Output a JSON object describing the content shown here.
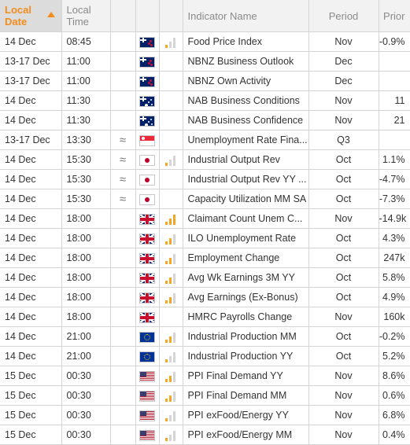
{
  "columns": {
    "local_date": "Local Date",
    "local_time": "Local Time",
    "indicator_name": "Indicator Name",
    "period": "Period",
    "prior": "Prior"
  },
  "rows": [
    {
      "date": "14 Dec",
      "time": "08:45",
      "approx": "",
      "flag": "nz-flag-icon",
      "flag_class": "flag-nz",
      "vol": 1,
      "name": "Food Price Index",
      "period": "Nov",
      "prior": "-0.9%"
    },
    {
      "date": "13-17 Dec",
      "time": "11:00",
      "approx": "",
      "flag": "nz-flag-icon",
      "flag_class": "flag-nz",
      "vol": 0,
      "name": "NBNZ Business Outlook",
      "period": "Dec",
      "prior": ""
    },
    {
      "date": "13-17 Dec",
      "time": "11:00",
      "approx": "",
      "flag": "nz-flag-icon",
      "flag_class": "flag-nz",
      "vol": 0,
      "name": "NBNZ Own Activity",
      "period": "Dec",
      "prior": ""
    },
    {
      "date": "14 Dec",
      "time": "11:30",
      "approx": "",
      "flag": "au-flag-icon",
      "flag_class": "flag-au",
      "vol": 0,
      "name": "NAB Business Conditions",
      "period": "Nov",
      "prior": "11"
    },
    {
      "date": "14 Dec",
      "time": "11:30",
      "approx": "",
      "flag": "au-flag-icon",
      "flag_class": "flag-au",
      "vol": 0,
      "name": "NAB Business Confidence",
      "period": "Nov",
      "prior": "21"
    },
    {
      "date": "13-17 Dec",
      "time": "13:30",
      "approx": "≈",
      "flag": "sg-flag-icon",
      "flag_class": "flag-sg",
      "vol": 0,
      "name": "Unemployment Rate Fina...",
      "period": "Q3",
      "prior": ""
    },
    {
      "date": "14 Dec",
      "time": "15:30",
      "approx": "≈",
      "flag": "jp-flag-icon",
      "flag_class": "flag-jp",
      "vol": 1,
      "name": "Industrial Output Rev",
      "period": "Oct",
      "prior": "1.1%"
    },
    {
      "date": "14 Dec",
      "time": "15:30",
      "approx": "≈",
      "flag": "jp-flag-icon",
      "flag_class": "flag-jp",
      "vol": 0,
      "name": "Industrial Output Rev YY ...",
      "period": "Oct",
      "prior": "-4.7%"
    },
    {
      "date": "14 Dec",
      "time": "15:30",
      "approx": "≈",
      "flag": "jp-flag-icon",
      "flag_class": "flag-jp",
      "vol": 0,
      "name": "Capacity Utilization MM SA",
      "period": "Oct",
      "prior": "-7.3%"
    },
    {
      "date": "14 Dec",
      "time": "18:00",
      "approx": "",
      "flag": "gb-flag-icon",
      "flag_class": "flag-gb",
      "vol": 3,
      "name": "Claimant Count Unem C...",
      "period": "Nov",
      "prior": "-14.9k"
    },
    {
      "date": "14 Dec",
      "time": "18:00",
      "approx": "",
      "flag": "gb-flag-icon",
      "flag_class": "flag-gb",
      "vol": 2,
      "name": "ILO Unemployment Rate",
      "period": "Oct",
      "prior": "4.3%"
    },
    {
      "date": "14 Dec",
      "time": "18:00",
      "approx": "",
      "flag": "gb-flag-icon",
      "flag_class": "flag-gb",
      "vol": 2,
      "name": "Employment Change",
      "period": "Oct",
      "prior": "247k"
    },
    {
      "date": "14 Dec",
      "time": "18:00",
      "approx": "",
      "flag": "gb-flag-icon",
      "flag_class": "flag-gb",
      "vol": 2,
      "name": "Avg Wk Earnings 3M YY",
      "period": "Oct",
      "prior": "5.8%"
    },
    {
      "date": "14 Dec",
      "time": "18:00",
      "approx": "",
      "flag": "gb-flag-icon",
      "flag_class": "flag-gb",
      "vol": 2,
      "name": "Avg Earnings (Ex-Bonus)",
      "period": "Oct",
      "prior": "4.9%"
    },
    {
      "date": "14 Dec",
      "time": "18:00",
      "approx": "",
      "flag": "gb-flag-icon",
      "flag_class": "flag-gb",
      "vol": 0,
      "name": "HMRC Payrolls Change",
      "period": "Nov",
      "prior": "160k"
    },
    {
      "date": "14 Dec",
      "time": "21:00",
      "approx": "",
      "flag": "eu-flag-icon",
      "flag_class": "flag-eu",
      "vol": 2,
      "name": "Industrial Production MM",
      "period": "Oct",
      "prior": "-0.2%"
    },
    {
      "date": "14 Dec",
      "time": "21:00",
      "approx": "",
      "flag": "eu-flag-icon",
      "flag_class": "flag-eu",
      "vol": 1,
      "name": "Industrial Production YY",
      "period": "Oct",
      "prior": "5.2%"
    },
    {
      "date": "15 Dec",
      "time": "00:30",
      "approx": "",
      "flag": "us-flag-icon",
      "flag_class": "flag-us",
      "vol": 2,
      "name": "PPI Final Demand YY",
      "period": "Nov",
      "prior": "8.6%"
    },
    {
      "date": "15 Dec",
      "time": "00:30",
      "approx": "",
      "flag": "us-flag-icon",
      "flag_class": "flag-us",
      "vol": 2,
      "name": "PPI Final Demand MM",
      "period": "Nov",
      "prior": "0.6%"
    },
    {
      "date": "15 Dec",
      "time": "00:30",
      "approx": "",
      "flag": "us-flag-icon",
      "flag_class": "flag-us",
      "vol": 1,
      "name": "PPI exFood/Energy YY",
      "period": "Nov",
      "prior": "6.8%"
    },
    {
      "date": "15 Dec",
      "time": "00:30",
      "approx": "",
      "flag": "us-flag-icon",
      "flag_class": "flag-us",
      "vol": 1,
      "name": "PPI exFood/Energy MM",
      "period": "Nov",
      "prior": "0.4%"
    }
  ],
  "colors": {
    "accent": "#f28c1c",
    "volatility_bar": "#f5a623",
    "header_bg": "#f2f2f2",
    "sorted_header_bg": "#dcdcdc"
  }
}
